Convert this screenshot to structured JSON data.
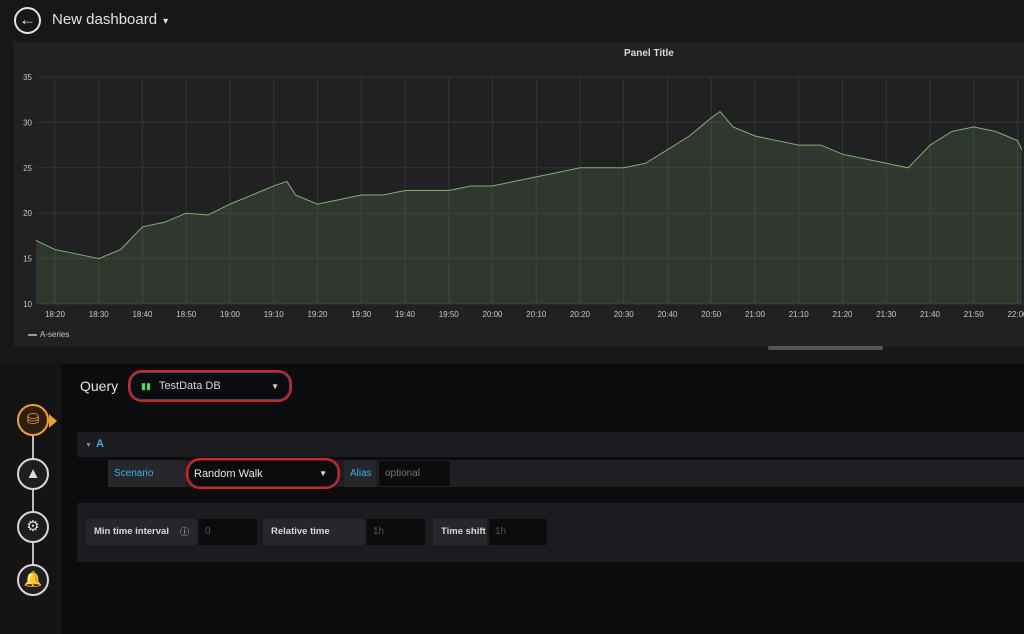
{
  "header": {
    "title": "New dashboard",
    "back_icon": "arrow-left-circle-icon"
  },
  "panel": {
    "title": "Panel Title",
    "legend": [
      {
        "name": "A-series",
        "color": "#7eb26d"
      }
    ]
  },
  "chart_data": {
    "type": "area",
    "x_ticks": [
      "18:20",
      "18:30",
      "18:40",
      "18:50",
      "19:00",
      "19:10",
      "19:20",
      "19:30",
      "19:40",
      "19:50",
      "20:00",
      "20:10",
      "20:20",
      "20:30",
      "20:40",
      "20:50",
      "21:00",
      "21:10",
      "21:20",
      "21:30",
      "21:40",
      "21:50",
      "22:00"
    ],
    "y_ticks": [
      10,
      15,
      20,
      25,
      30,
      35
    ],
    "ylim": [
      10,
      35
    ],
    "xlim": [
      "18:15",
      "22:01"
    ],
    "grid": true,
    "legend_position": "bottom-left",
    "series": [
      {
        "name": "A-series",
        "color": "#7eb26d",
        "x": [
          "18:15",
          "18:20",
          "18:25",
          "18:30",
          "18:35",
          "18:40",
          "18:45",
          "18:50",
          "18:55",
          "19:00",
          "19:05",
          "19:10",
          "19:13",
          "19:15",
          "19:20",
          "19:25",
          "19:30",
          "19:35",
          "19:40",
          "19:45",
          "19:50",
          "19:55",
          "20:00",
          "20:05",
          "20:10",
          "20:15",
          "20:20",
          "20:25",
          "20:30",
          "20:35",
          "20:40",
          "20:45",
          "20:50",
          "20:52",
          "20:55",
          "21:00",
          "21:05",
          "21:10",
          "21:15",
          "21:20",
          "21:25",
          "21:30",
          "21:35",
          "21:40",
          "21:45",
          "21:50",
          "21:55",
          "22:00",
          "22:01"
        ],
        "y": [
          17,
          16,
          15.5,
          15,
          16,
          18.5,
          19,
          20,
          19.8,
          21,
          22,
          23,
          23.5,
          22,
          21,
          21.5,
          22,
          22,
          22.5,
          22.5,
          22.5,
          23,
          23,
          23.5,
          24,
          24.5,
          25,
          25,
          25,
          25.5,
          27,
          28.5,
          30.5,
          31.2,
          29.5,
          28.5,
          28,
          27.5,
          27.5,
          26.5,
          26,
          25.5,
          25,
          27.5,
          29,
          29.5,
          29,
          28,
          27
        ]
      }
    ]
  },
  "query": {
    "label": "Query",
    "datasource": "TestData DB",
    "query_ref": "A",
    "scenario_label": "Scenario",
    "scenario": "Random Walk",
    "alias_label": "Alias",
    "alias_placeholder": "optional",
    "min_interval_label": "Min time interval",
    "min_interval_placeholder": "0",
    "relative_time_label": "Relative time",
    "relative_time_placeholder": "1h",
    "time_shift_label": "Time shift",
    "time_shift_placeholder": "1h"
  },
  "sidebar": {
    "steps": [
      {
        "icon": "database-icon",
        "active": true
      },
      {
        "icon": "area-chart-icon"
      },
      {
        "icon": "gear-wrench-icon"
      },
      {
        "icon": "bell-icon"
      }
    ]
  },
  "colors": {
    "accent": "#33b5e5",
    "active_step": "#f0a030",
    "highlight": "#e02020"
  }
}
